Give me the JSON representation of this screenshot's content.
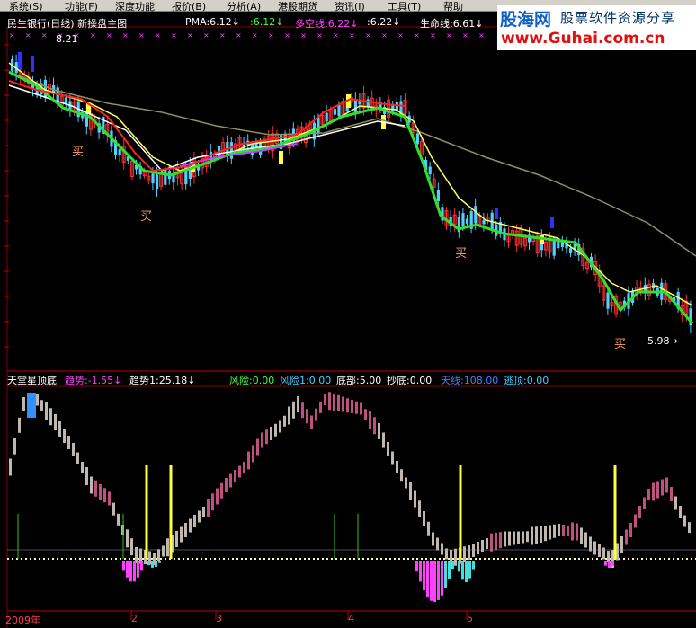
{
  "menu": {
    "items": [
      "系统(S)",
      "功能(F)",
      "深度功能",
      "报价(B)",
      "分析(A)",
      "港股期货",
      "资讯(I)",
      "工具(T)",
      "帮助"
    ]
  },
  "logo": {
    "brand": "股海网",
    "slogan": "股票软件资源分享",
    "url": "www.Guhai.com.cn"
  },
  "price_panel": {
    "title": "民生银行(日线) 新操盘主图",
    "indicators": [
      {
        "label": "PMA:6.12",
        "arrow": "↓",
        "color": "#ffffff"
      },
      {
        "label": ":6.12",
        "arrow": "↓",
        "color": "#40ff40"
      },
      {
        "label": "多空线:6.22",
        "arrow": "↓",
        "color": "#ff40ff"
      },
      {
        "label": ":6.22",
        "arrow": "↓",
        "color": "#ffffff"
      },
      {
        "label": "生命线:6.61",
        "arrow": "↓",
        "color": "#ffffff"
      }
    ],
    "high_label": "8.21",
    "low_label": "5.98",
    "buy_label": "买"
  },
  "indicator_panel": {
    "title": "天堂星顶底",
    "values": [
      {
        "label": "趋势:-1.55",
        "arrow": "↓",
        "color": "#ff40ff"
      },
      {
        "label": "趋势1:25.18",
        "arrow": "↓",
        "color": "#ffffff"
      },
      {
        "label": "风险:0.00",
        "color": "#40ff40"
      },
      {
        "label": "风险1:0.00",
        "color": "#40d0ff"
      },
      {
        "label": "底部:5.00",
        "color": "#ffffff"
      },
      {
        "label": "抄底:0.00",
        "color": "#ffffff"
      },
      {
        "label": "天线:108.00",
        "color": "#4080ff"
      },
      {
        "label": "逃顶:0.00",
        "color": "#40d0ff"
      }
    ]
  },
  "time_axis": [
    "2009年",
    "2",
    "3",
    "4",
    "5"
  ],
  "colors": {
    "up": "#ff3030",
    "down": "#50d0ff",
    "ma_white": "#ffffff",
    "ma_yellow": "#ffff60",
    "ma_green": "#30e030",
    "ma_purple": "#c040ff",
    "ma_olive": "#909060",
    "bar_grey": "#c0b8b0",
    "bar_pink": "#c05080",
    "magenta": "#ff40ff",
    "cyan": "#40e0e0",
    "signal_yellow": "#ffff40"
  }
}
